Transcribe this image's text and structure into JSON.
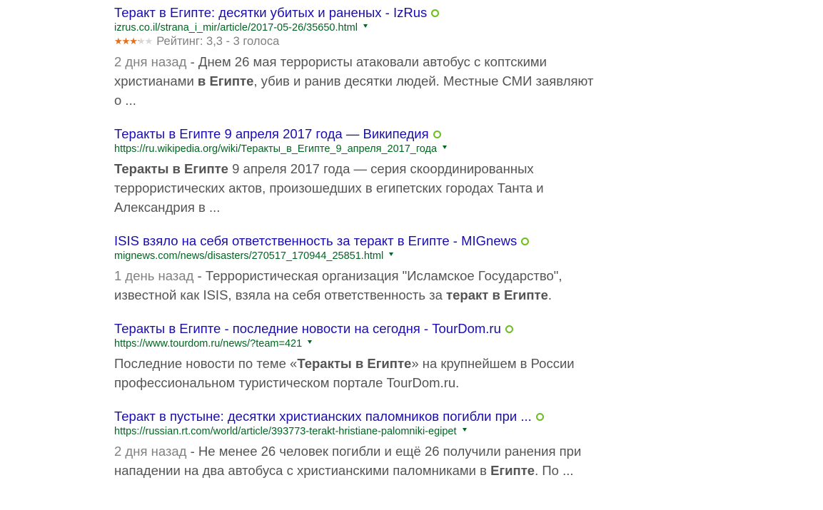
{
  "results": [
    {
      "title": "Теракт в Египте: десятки убитых и раненых - IzRus",
      "url": "izrus.co.il/strana_i_mir/article/2017-05-26/35650.html",
      "rating": {
        "stars_value": 3.3,
        "stars_max": 5,
        "text": "Рейтинг: 3,3 - 3 голоса"
      },
      "snippet": [
        {
          "text": "2 дня назад",
          "style": "date"
        },
        {
          "text": " - Днем 26 мая террористы атаковали автобус с коптскими христианами ",
          "style": "normal"
        },
        {
          "text": "в",
          "style": "bold"
        },
        {
          "text": " ",
          "style": "normal"
        },
        {
          "text": "Египте",
          "style": "bold"
        },
        {
          "text": ", убив и ранив десятки людей. Местные СМИ заявляют о ...",
          "style": "normal"
        }
      ]
    },
    {
      "title": "Теракты в Египте 9 апреля 2017 года — Википедия",
      "url": "https://ru.wikipedia.org/wiki/Теракты_в_Египте_9_апреля_2017_года",
      "snippet": [
        {
          "text": "Теракты в Египте",
          "style": "bold"
        },
        {
          "text": " 9 апреля 2017 года — серия скоординированных террористических актов, произошедших в египетских городах Танта и Александрия в ...",
          "style": "normal"
        }
      ]
    },
    {
      "title": "ISIS взяло на себя ответственность за теракт в Египте - MIGnews",
      "url": "mignews.com/news/disasters/270517_170944_25851.html",
      "snippet": [
        {
          "text": "1 день назад",
          "style": "date"
        },
        {
          "text": " - Террористическая организация \"Исламское Государство\", известной как ISIS, взяла на себя ответственность за ",
          "style": "normal"
        },
        {
          "text": "теракт в Египте",
          "style": "bold"
        },
        {
          "text": ".",
          "style": "normal"
        }
      ]
    },
    {
      "title": "Теракты в Египте - последние новости на сегодня - TourDom.ru",
      "url": "https://www.tourdom.ru/news/?team=421",
      "snippet": [
        {
          "text": "Последние новости по теме «",
          "style": "normal"
        },
        {
          "text": "Теракты в Египте",
          "style": "bold"
        },
        {
          "text": "» на крупнейшем в России профессиональном туристическом портале TourDom.ru.",
          "style": "normal"
        }
      ]
    },
    {
      "title": "Теракт в пустыне: десятки христианских паломников погибли при ...",
      "url": "https://russian.rt.com/world/article/393773-terakt-hristiane-palomniki-egipet",
      "snippet": [
        {
          "text": "2 дня назад",
          "style": "date"
        },
        {
          "text": " - Не менее 26 человек погибли и ещё 26 получили ранения при нападении на два автобуса с христианскими паломниками в ",
          "style": "normal"
        },
        {
          "text": "Египте",
          "style": "bold"
        },
        {
          "text": ". По ...",
          "style": "normal"
        }
      ]
    }
  ],
  "colors": {
    "title": "#1a0dab",
    "url": "#006621",
    "snippet": "#545454",
    "date": "#808080",
    "star_filled": "#e7711b",
    "star_empty": "#d7d7d7",
    "green_dot": "#6cbf1c"
  },
  "icons": {
    "green_dot": "green-circle-icon",
    "url_menu": "triangle-down-icon",
    "star": "star-icon"
  }
}
